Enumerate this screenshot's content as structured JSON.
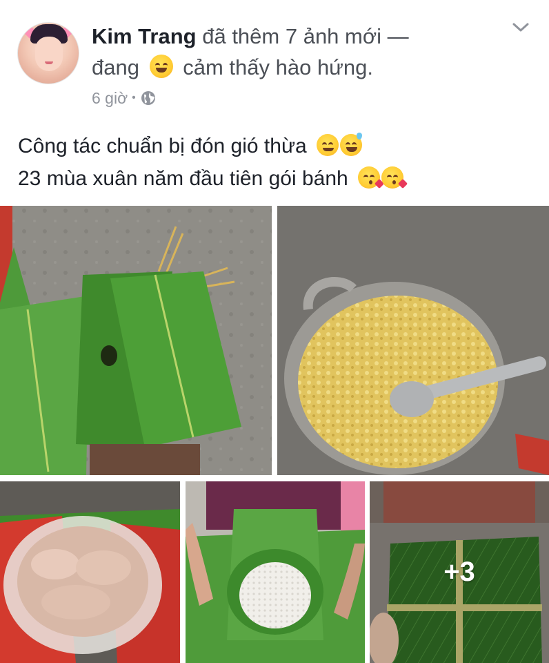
{
  "post": {
    "author": "Kim Trang",
    "action": "đã thêm 7 ảnh mới —",
    "feeling_prefix": "đang",
    "feeling": "cảm thấy hào hứng.",
    "time": "6 giờ",
    "separator": "•",
    "caption_line1": "Công tác chuẩn bị đón gió thừa",
    "caption_line2": "23 mùa xuân năm đầu tiên gói bánh",
    "more_photos": "+3"
  },
  "icons": {
    "audience": "globe-icon",
    "menu": "chevron-down-icon",
    "feeling": "grinning-face-icon"
  },
  "colors": {
    "name": "#1d2129",
    "secondary_text": "#4b4f56",
    "meta_text": "#90949c",
    "leaf_green": "#3f8a2c"
  }
}
